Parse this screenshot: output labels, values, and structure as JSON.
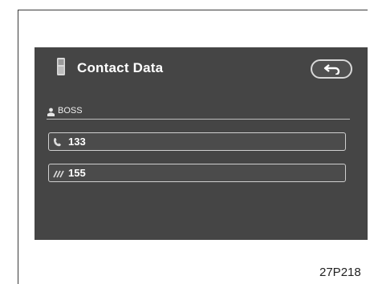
{
  "screen": {
    "title": "Contact Data",
    "contact_name": "BOSS",
    "numbers": [
      {
        "icon": "phone-handset-icon",
        "value": "133"
      },
      {
        "icon": "mobile-signal-icon",
        "value": "155"
      }
    ],
    "back_icon": "return-arrow-icon"
  },
  "figure_code": "27P218",
  "colors": {
    "screen_bg": "#454545",
    "text": "#ffffff",
    "border": "#cfcfcf"
  }
}
